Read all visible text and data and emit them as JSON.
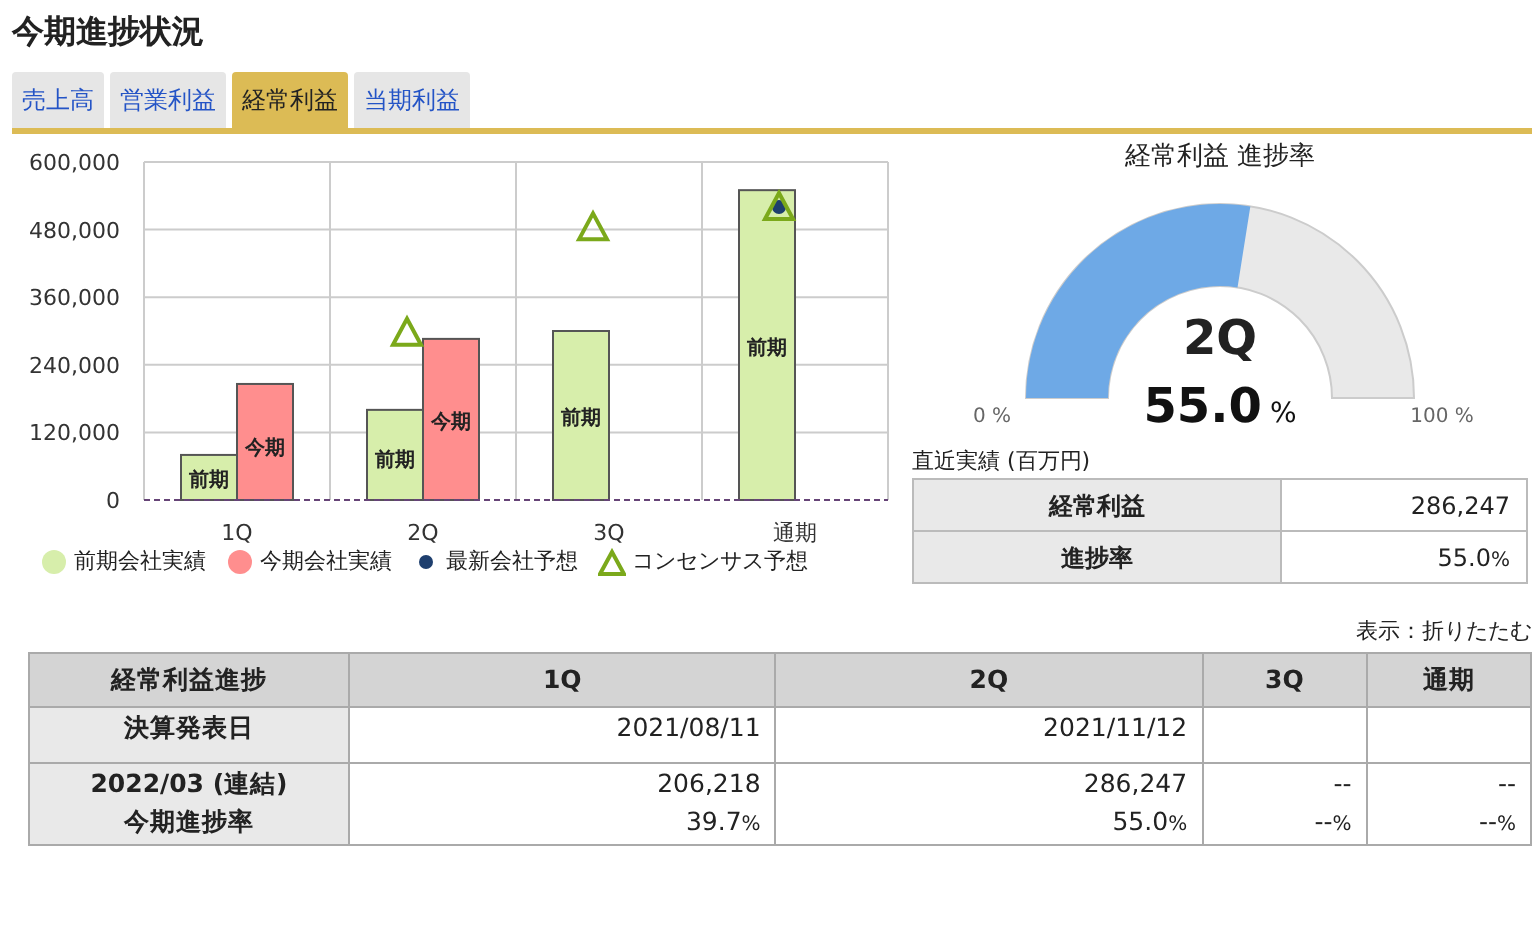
{
  "title": "今期進捗状況",
  "tabs": [
    {
      "label": "売上高",
      "selected": false
    },
    {
      "label": "営業利益",
      "selected": false
    },
    {
      "label": "経常利益",
      "selected": true
    },
    {
      "label": "当期利益",
      "selected": false
    }
  ],
  "chart": {
    "chart_data": {
      "type": "bar",
      "categories": [
        "1Q",
        "2Q",
        "3Q",
        "通期"
      ],
      "ylim": [
        0,
        600000
      ],
      "yticks": [
        {
          "value": 0,
          "label": "0"
        },
        {
          "value": 120000,
          "label": "120,000"
        },
        {
          "value": 240000,
          "label": "240,000"
        },
        {
          "value": 360000,
          "label": "360,000"
        },
        {
          "value": 480000,
          "label": "480,000"
        },
        {
          "value": 600000,
          "label": "600,000"
        }
      ],
      "stacked": false,
      "grid": true,
      "series": [
        {
          "name": "前期会社実績",
          "type": "bar",
          "color": "#d7eeab",
          "values": [
            80000,
            160000,
            300000,
            550000
          ]
        },
        {
          "name": "今期会社実績",
          "type": "bar",
          "color": "#ff8e8e",
          "values": [
            206000,
            286000,
            null,
            null
          ]
        },
        {
          "name": "最新会社予想",
          "type": "scatter",
          "marker": "circle",
          "color": "#1e3f6e",
          "values": [
            null,
            null,
            null,
            520000
          ]
        },
        {
          "name": "コンセンサス予想",
          "type": "scatter",
          "marker": "triangle",
          "color": "#7ba91b",
          "values": [
            null,
            297000,
            484000,
            520000
          ]
        }
      ],
      "annotations": [
        {
          "x": "1Q",
          "y": 39000,
          "text": "前期"
        },
        {
          "x": "1Q",
          "y": 96000,
          "text": "今期"
        },
        {
          "x": "2Q",
          "y": 75000,
          "text": "前期"
        },
        {
          "x": "2Q",
          "y": 142000,
          "text": "今期"
        },
        {
          "x": "3Q",
          "y": 149000,
          "text": "前期"
        },
        {
          "x": "通期",
          "y": 273000,
          "text": "前期"
        }
      ]
    }
  },
  "gauge": {
    "title": "経常利益 進捗率",
    "level": 0.55,
    "period": "2Q",
    "value": "55.0",
    "unit": "%",
    "min_label": "0 %",
    "max_label": "100 %"
  },
  "recent": {
    "caption": "直近実績 (百万円)",
    "rows": [
      {
        "label": "経常利益",
        "value": "286,247",
        "unit": ""
      },
      {
        "label": "進捗率",
        "value": "55.0",
        "unit": "%"
      }
    ]
  },
  "display": {
    "label": "表示：",
    "link": "折りたたむ"
  },
  "table": {
    "columns": [
      "経常利益進捗",
      "1Q",
      "2Q",
      "3Q",
      "通期"
    ],
    "rows": [
      {
        "cells": [
          [
            {
              "v": "決算発表日"
            }
          ],
          [
            {
              "v": "2021/08/11"
            }
          ],
          [
            {
              "v": "2021/11/12"
            }
          ],
          [],
          []
        ]
      },
      {
        "cells": [
          [
            {
              "v": "2022/03 (連結)"
            },
            {
              "v": "今期進捗率"
            }
          ],
          [
            {
              "v": "206,218"
            },
            {
              "v": "39.7",
              "u": "%"
            }
          ],
          [
            {
              "v": "286,247"
            },
            {
              "v": "55.0",
              "u": "%"
            }
          ],
          [
            {
              "v": "--"
            },
            {
              "v": "--",
              "u": "%"
            }
          ],
          [
            {
              "v": "--"
            },
            {
              "v": "--",
              "u": "%"
            }
          ]
        ]
      }
    ]
  }
}
